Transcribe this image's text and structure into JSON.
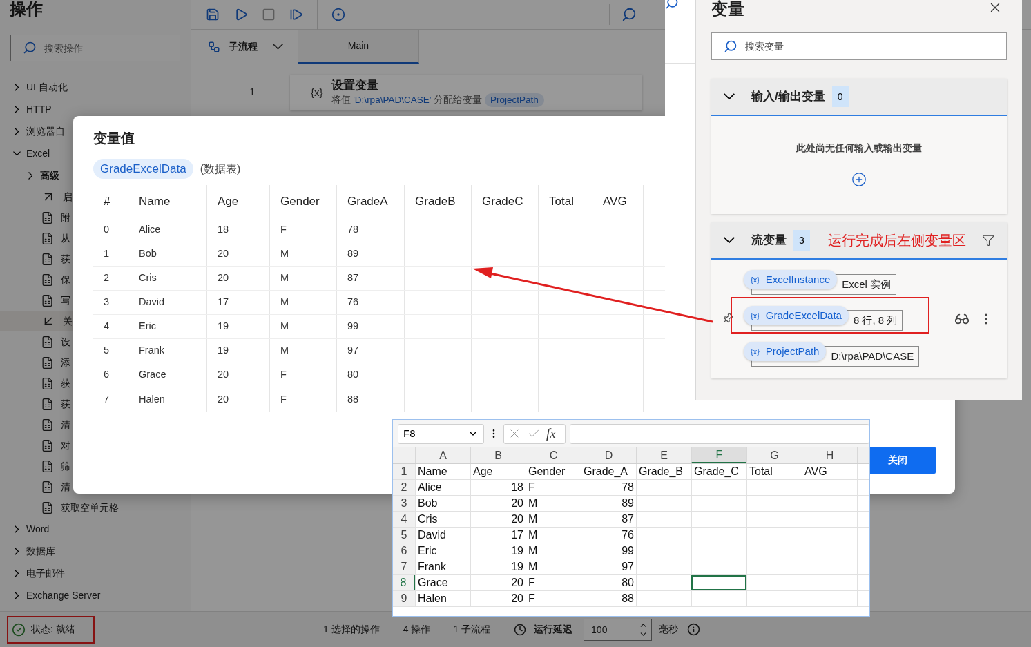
{
  "sidebar": {
    "title": "操作",
    "search_placeholder": "搜索操作",
    "groups": [
      {
        "label": "UI 自动化",
        "expanded": false
      },
      {
        "label": "HTTP",
        "expanded": false
      },
      {
        "label": "浏览器自",
        "expanded": false
      },
      {
        "label": "Excel",
        "expanded": true,
        "children": [
          {
            "label": "高级",
            "kind": "folder",
            "expanded": false
          },
          {
            "label": "启",
            "kind": "launch",
            "selected": false
          },
          {
            "label": "附",
            "kind": "excel",
            "selected": false
          },
          {
            "label": "从",
            "kind": "excel",
            "selected": false
          },
          {
            "label": "获",
            "kind": "excel",
            "selected": false
          },
          {
            "label": "保",
            "kind": "excel",
            "selected": false
          },
          {
            "label": "写",
            "kind": "excel",
            "selected": false
          },
          {
            "label": "关",
            "kind": "close",
            "selected": true
          },
          {
            "label": "设",
            "kind": "excel",
            "selected": false
          },
          {
            "label": "添",
            "kind": "excel",
            "selected": false
          },
          {
            "label": "获",
            "kind": "excel",
            "selected": false
          },
          {
            "label": "获",
            "kind": "excel",
            "selected": false
          },
          {
            "label": "清",
            "kind": "excel",
            "selected": false
          },
          {
            "label": "对",
            "kind": "excel",
            "selected": false
          },
          {
            "label": "筛",
            "kind": "excel",
            "selected": false
          },
          {
            "label": "清",
            "kind": "excel",
            "selected": false
          },
          {
            "label": "获取空单元格",
            "kind": "excel",
            "selected": false
          }
        ]
      },
      {
        "label": "Word",
        "expanded": false
      },
      {
        "label": "数据库",
        "expanded": false
      },
      {
        "label": "电子邮件",
        "expanded": false
      },
      {
        "label": "Exchange Server",
        "expanded": false
      }
    ]
  },
  "designer": {
    "subflow_label": "子流程",
    "tabs": [
      {
        "label": "Main",
        "selected": true
      }
    ],
    "steps": [
      {
        "number": "1",
        "icon_text": "{x}",
        "title": "设置变量",
        "prefix": "将值 ",
        "value": "'D:\\rpa\\PAD\\CASE'",
        "suffix": " 分配给变量",
        "variable": "ProjectPath"
      }
    ]
  },
  "status_bar": {
    "status": "状态: 就绪",
    "annotated": true,
    "selected_actions": "1 选择的操作",
    "actions": "4 操作",
    "subflows": "1 子流程",
    "delay_label": "运行延迟",
    "delay_value": "100",
    "delay_unit": "毫秒"
  },
  "variable_dialog": {
    "title": "变量值",
    "variable": "GradeExcelData",
    "type": "(数据表)",
    "columns": [
      "#",
      "Name",
      "Age",
      "Gender",
      "GradeA",
      "GradeB",
      "GradeC",
      "Total",
      "AVG"
    ],
    "rows": [
      [
        "0",
        "Alice",
        "18",
        "F",
        "78"
      ],
      [
        "1",
        "Bob",
        "20",
        "M",
        "89"
      ],
      [
        "2",
        "Cris",
        "20",
        "M",
        "87"
      ],
      [
        "3",
        "David",
        "17",
        "M",
        "76"
      ],
      [
        "4",
        "Eric",
        "19",
        "M",
        "99"
      ],
      [
        "5",
        "Frank",
        "19",
        "M",
        "97"
      ],
      [
        "6",
        "Grace",
        "20",
        "F",
        "80"
      ],
      [
        "7",
        "Halen",
        "20",
        "F",
        "88"
      ]
    ],
    "close_button": "关闭"
  },
  "variables_panel": {
    "title": "变量",
    "search_placeholder": "搜索变量",
    "sections": [
      {
        "title": "输入/输出变量",
        "count": "0",
        "expanded": true,
        "empty_text": "此处尚无任何输入或输出变量"
      },
      {
        "title": "流变量",
        "count": "3",
        "expanded": true,
        "annotation": "运行完成后左侧变量区",
        "variables": [
          {
            "badge": "{x}",
            "name": "ExcelInstance",
            "value": "Excel 实例",
            "highlighted": false
          },
          {
            "badge": "{x}",
            "name": "GradeExcelData",
            "value": "8 行, 8 列",
            "highlighted": true
          },
          {
            "badge": "{x}",
            "name": "ProjectPath",
            "value": "D:\\rpa\\PAD\\CASE",
            "highlighted": false
          }
        ]
      }
    ]
  },
  "excel": {
    "name_box": "F8",
    "function_label": "fx",
    "columns": [
      {
        "label": "A",
        "selected": false
      },
      {
        "label": "B",
        "selected": false
      },
      {
        "label": "C",
        "selected": false
      },
      {
        "label": "D",
        "selected": false
      },
      {
        "label": "E",
        "selected": false
      },
      {
        "label": "F",
        "selected": true
      },
      {
        "label": "G",
        "selected": false
      },
      {
        "label": "H",
        "selected": false
      }
    ],
    "rows": [
      {
        "number": "1",
        "selected": false,
        "cells": [
          "Name",
          "Age",
          "Gender",
          "Grade_A",
          "Grade_B",
          "Grade_C",
          "Total",
          "AVG"
        ]
      },
      {
        "number": "2",
        "selected": false,
        "cells": [
          "Alice",
          "18",
          "F",
          "78"
        ]
      },
      {
        "number": "3",
        "selected": false,
        "cells": [
          "Bob",
          "20",
          "M",
          "89"
        ]
      },
      {
        "number": "4",
        "selected": false,
        "cells": [
          "Cris",
          "20",
          "M",
          "87"
        ]
      },
      {
        "number": "5",
        "selected": false,
        "cells": [
          "David",
          "17",
          "M",
          "76"
        ]
      },
      {
        "number": "6",
        "selected": false,
        "cells": [
          "Eric",
          "19",
          "M",
          "99"
        ]
      },
      {
        "number": "7",
        "selected": false,
        "cells": [
          "Frank",
          "19",
          "M",
          "97"
        ]
      },
      {
        "number": "8",
        "selected": true,
        "cells": [
          "Grace",
          "20",
          "F",
          "80"
        ]
      },
      {
        "number": "9",
        "selected": false,
        "cells": [
          "Halen",
          "20",
          "F",
          "88"
        ]
      }
    ]
  }
}
